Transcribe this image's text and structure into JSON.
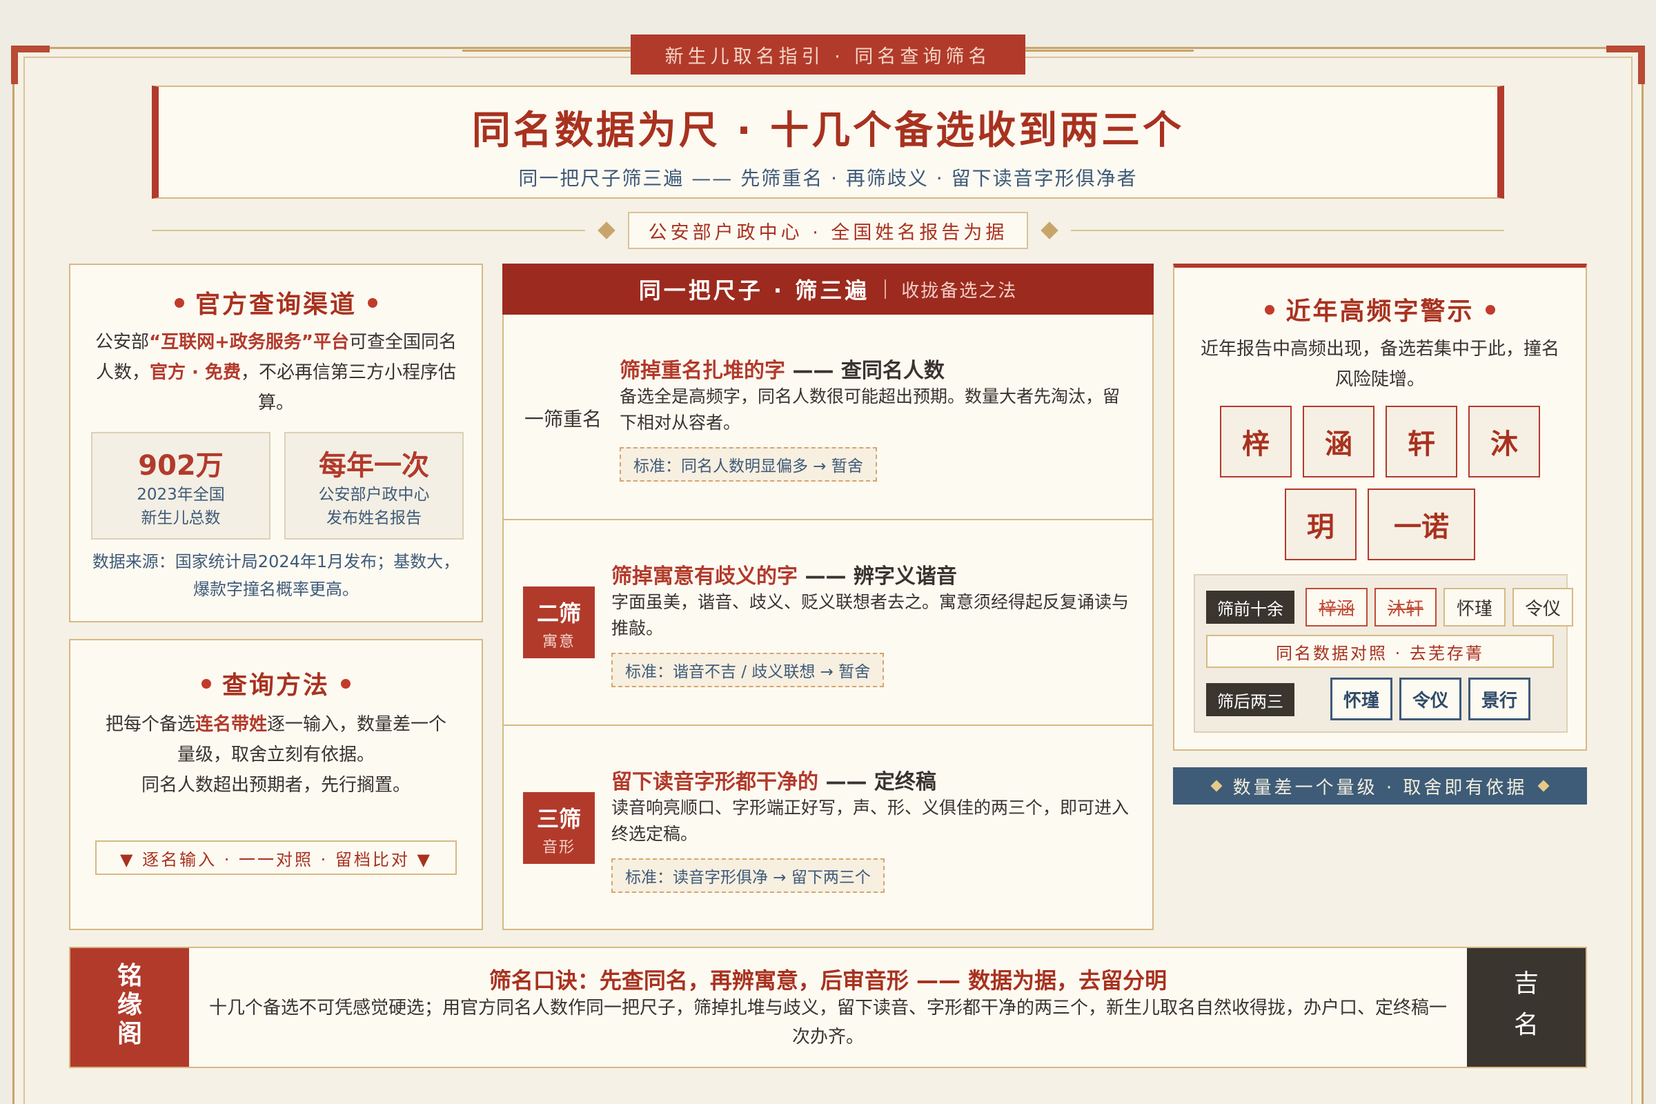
{
  "banner": "新生儿取名指引 · 同名查询筛名",
  "title": "同名数据为尺 · 十几个备选收到两三个",
  "subtitle": "同一把尺子筛三遍 —— 先筛重名 · 再筛歧义 · 留下读音字形俱净者",
  "source_tag": "公安部户政中心 · 全国姓名报告为据",
  "official": {
    "title": "官方查询渠道",
    "text_prefix": "公安部",
    "text_platform": "“互联网+政务服务”平台",
    "text_mid": "可查全国同名人数，",
    "text_free": "官方 · 免费",
    "text_suffix": "，不必再信第三方小程序估算。",
    "stat1_value": "902万",
    "stat1_caption1": "2023年全国",
    "stat1_caption2": "新生儿总数",
    "stat2_value": "每年一次",
    "stat2_caption1": "公安部户政中心",
    "stat2_caption2": "发布姓名报告",
    "note": "数据来源：国家统计局2024年1月发布；基数大，爆款字撞名概率更高。"
  },
  "method": {
    "title": "查询方法",
    "text_prefix": "把每个备选",
    "text_hl": "连名带姓",
    "text_suffix": "逐一输入，数量差一个量级，取舍立刻有依据。",
    "text2": "同名人数超出预期者，先行搁置。",
    "action": "▼ 逐名输入 · 一一对照 · 留档比对 ▼"
  },
  "center": {
    "head_big": "同一把尺子 · 筛三遍",
    "head_small": "收拢备选之法",
    "steps": [
      {
        "label": "一筛重名",
        "title_red": "筛掉重名扎堆的字",
        "title_dark": " —— 查同名人数",
        "desc": "备选全是高频字，同名人数很可能超出预期。数量大者先淘汰，留下相对从容者。",
        "std": "标准：同名人数明显偏多 → 暂舍"
      },
      {
        "badge1": "二筛",
        "badge2": "寓意",
        "title_red": "筛掉寓意有歧义的字",
        "title_dark": " —— 辨字义谐音",
        "desc": "字面虽美，谐音、歧义、贬义联想者去之。寓意须经得起反复诵读与推敲。",
        "std": "标准：谐音不吉 / 歧义联想 → 暂舍"
      },
      {
        "badge1": "三筛",
        "badge2": "音形",
        "title_red": "留下读音字形都干净的",
        "title_dark": " —— 定终稿",
        "desc": "读音响亮顺口、字形端正好写，声、形、义俱佳的两三个，即可进入终选定稿。",
        "std": "标准：读音字形俱净 → 留下两三个"
      }
    ]
  },
  "warning": {
    "title": "近年高频字警示",
    "text": "近年报告中高频出现，备选若集中于此，撞名风险陡增。",
    "chars": [
      "梓",
      "涵",
      "轩",
      "沐",
      "玥",
      "一诺"
    ],
    "before_label": "筛前十余",
    "before_chips": [
      "梓涵",
      "沐轩",
      "怀瑾",
      "令仪"
    ],
    "compare_note": "同名数据对照 · 去芜存菁",
    "after_label": "筛后两三",
    "after_chips": [
      "怀瑾",
      "令仪",
      "景行"
    ],
    "bar": "数量差一个量级 · 取舍即有依据"
  },
  "footer": {
    "left_chars": [
      "铭",
      "缘",
      "阁"
    ],
    "right_chars": [
      "吉",
      "名"
    ],
    "title": "筛名口诀：先查同名，再辨寓意，后审音形 —— 数据为据，去留分明",
    "text": "十几个备选不可凭感觉硬选；用官方同名人数作同一把尺子，筛掉扎堆与歧义，留下读音、字形都干净的两三个，新生儿取名自然收得拢，办户口、定终稿一次办齐。"
  },
  "colors": {
    "accent_red": "#b23a2b",
    "dark_red": "#9c2a1e",
    "navy": "#3e5c78",
    "gold": "#c9a46a",
    "paper": "#fdfaf2"
  }
}
